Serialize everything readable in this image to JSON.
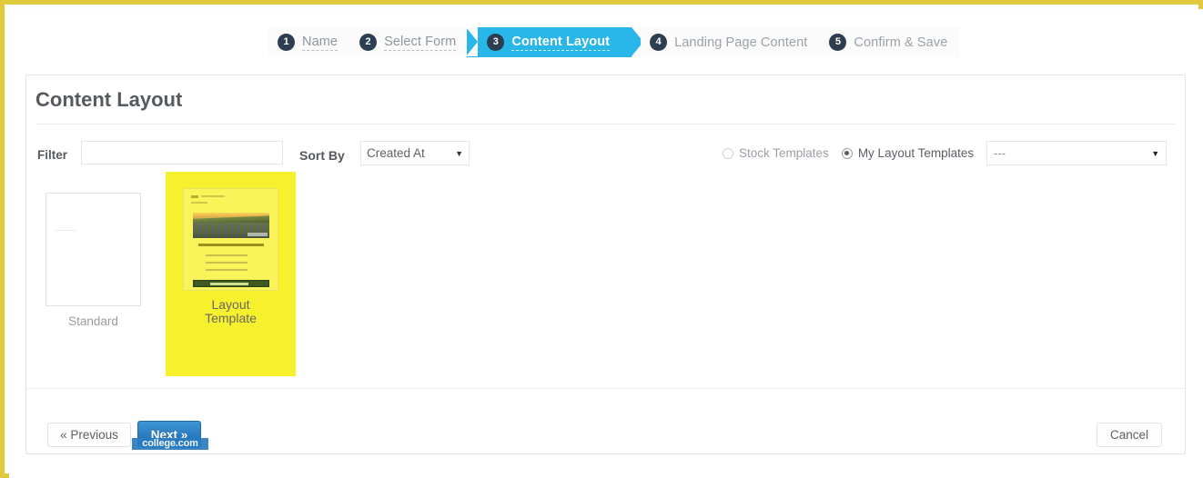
{
  "theme": {
    "frame_color": "#e0c93a",
    "active_step_color": "#29b6e8",
    "badge_color": "#2c3e50",
    "highlight_color": "#f7f12d",
    "primary_button_color": "#2a7cc0"
  },
  "wizard": {
    "steps": [
      {
        "number": "1",
        "label": "Name",
        "state": "done"
      },
      {
        "number": "2",
        "label": "Select Form",
        "state": "done"
      },
      {
        "number": "3",
        "label": "Content Layout",
        "state": "active"
      },
      {
        "number": "4",
        "label": "Landing Page Content",
        "state": "pending"
      },
      {
        "number": "5",
        "label": "Confirm & Save",
        "state": "pending"
      }
    ]
  },
  "card": {
    "title": "Content Layout"
  },
  "filters": {
    "filter_label": "Filter",
    "filter_value": "",
    "filter_placeholder": "",
    "sort_by_label": "Sort By",
    "sort_by_value": "Created At",
    "caret": "▼",
    "radios": [
      {
        "label": "Stock Templates",
        "selected": false
      },
      {
        "label": "My Layout Templates",
        "selected": true
      }
    ],
    "template_select_value": "---"
  },
  "gallery": {
    "templates": [
      {
        "name": "Standard",
        "selected": false
      },
      {
        "name_line1": "Layout",
        "name_line2": "Template",
        "selected": true
      }
    ]
  },
  "footer": {
    "previous_label": "« Previous",
    "next_label": "Next »",
    "cancel_label": "Cancel",
    "watermark": "college.com"
  }
}
